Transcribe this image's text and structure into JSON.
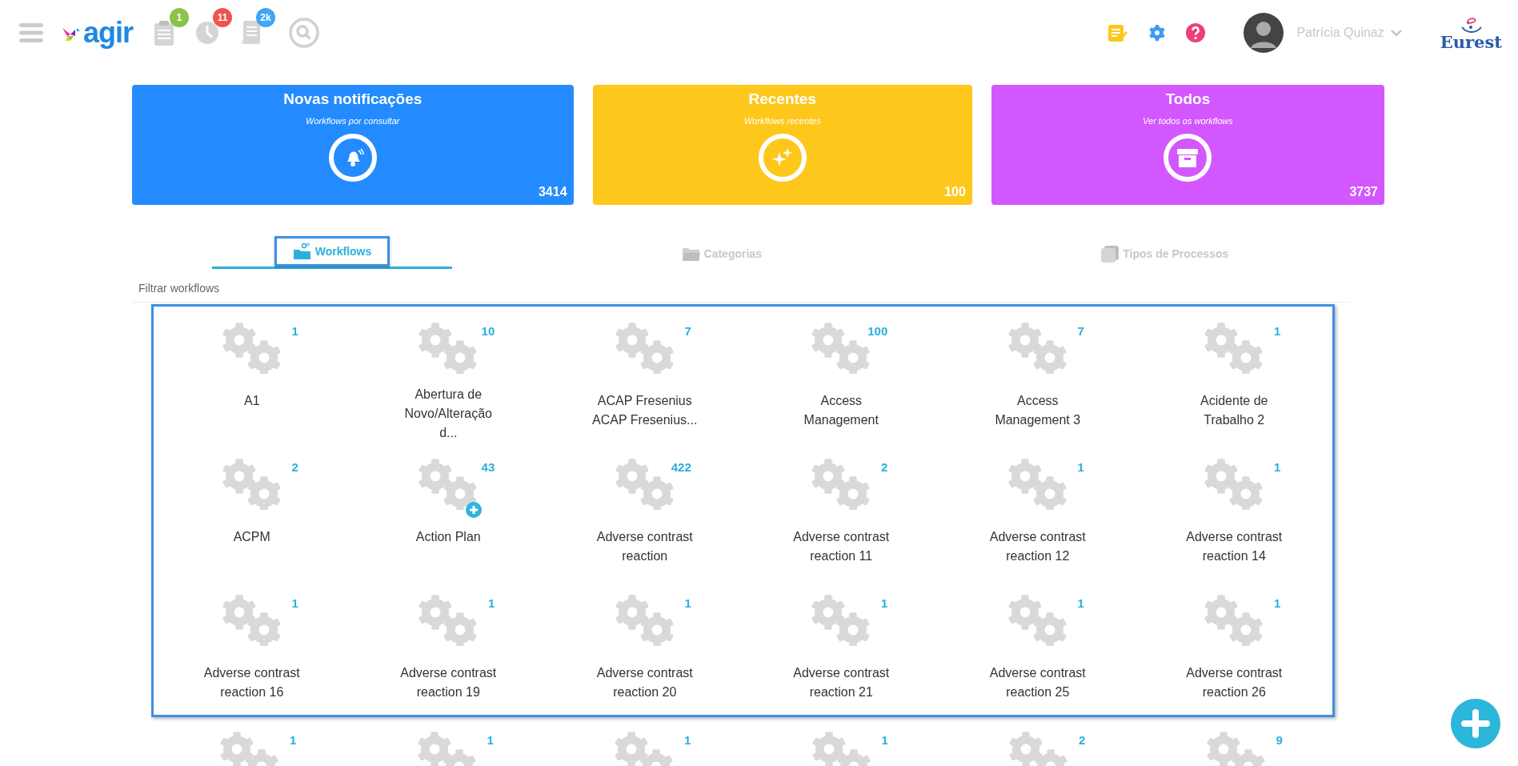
{
  "header": {
    "logo": "agir",
    "indicators": [
      {
        "kind": "clipboard",
        "badge": "1",
        "color": "#8bc34a"
      },
      {
        "kind": "clock",
        "badge": "11",
        "color": "#ef5350"
      },
      {
        "kind": "document",
        "badge": "2k",
        "color": "#42a5f5"
      }
    ],
    "user": {
      "name": "Patrícia Quinaz"
    },
    "brand": "Eurest"
  },
  "cards": [
    {
      "title": "Novas notificações",
      "subtitle": "Workflows por consultar",
      "count": "3414",
      "color": "#238bff"
    },
    {
      "title": "Recentes",
      "subtitle": "Workflows recentes",
      "count": "100",
      "color": "#fec71b"
    },
    {
      "title": "Todos",
      "subtitle": "Ver todos os workflows",
      "count": "3737",
      "color": "#d357fe"
    }
  ],
  "tabs": [
    {
      "label": "Workflows",
      "selected": true
    },
    {
      "label": "Categorias",
      "selected": false
    },
    {
      "label": "Tipos de Processos",
      "selected": false
    }
  ],
  "filter_label": "Filtrar workflows",
  "workflows": [
    {
      "name": "A1",
      "count": "1",
      "add_badge": false
    },
    {
      "name": "Abertura de Novo/Alteração d...",
      "count": "10",
      "add_badge": false
    },
    {
      "name": "ACAP Fresenius ACAP Fresenius...",
      "count": "7",
      "add_badge": false
    },
    {
      "name": "Access Management",
      "count": "100",
      "add_badge": false
    },
    {
      "name": "Access Management 3",
      "count": "7",
      "add_badge": false
    },
    {
      "name": "Acidente de Trabalho 2",
      "count": "1",
      "add_badge": false
    },
    {
      "name": "ACPM",
      "count": "2",
      "add_badge": false
    },
    {
      "name": "Action Plan",
      "count": "43",
      "add_badge": true
    },
    {
      "name": "Adverse contrast reaction",
      "count": "422",
      "add_badge": false
    },
    {
      "name": "Adverse contrast reaction 11",
      "count": "2",
      "add_badge": false
    },
    {
      "name": "Adverse contrast reaction 12",
      "count": "1",
      "add_badge": false
    },
    {
      "name": "Adverse contrast reaction 14",
      "count": "1",
      "add_badge": false
    },
    {
      "name": "Adverse contrast reaction 16",
      "count": "1",
      "add_badge": false
    },
    {
      "name": "Adverse contrast reaction 19",
      "count": "1",
      "add_badge": false
    },
    {
      "name": "Adverse contrast reaction 20",
      "count": "1",
      "add_badge": false
    },
    {
      "name": "Adverse contrast reaction 21",
      "count": "1",
      "add_badge": false
    },
    {
      "name": "Adverse contrast reaction 25",
      "count": "1",
      "add_badge": false
    },
    {
      "name": "Adverse contrast reaction 26",
      "count": "1",
      "add_badge": false
    }
  ],
  "partial_row": [
    {
      "count": "1"
    },
    {
      "count": "1"
    },
    {
      "count": "1"
    },
    {
      "count": "1"
    },
    {
      "count": "2"
    },
    {
      "count": "9"
    }
  ]
}
